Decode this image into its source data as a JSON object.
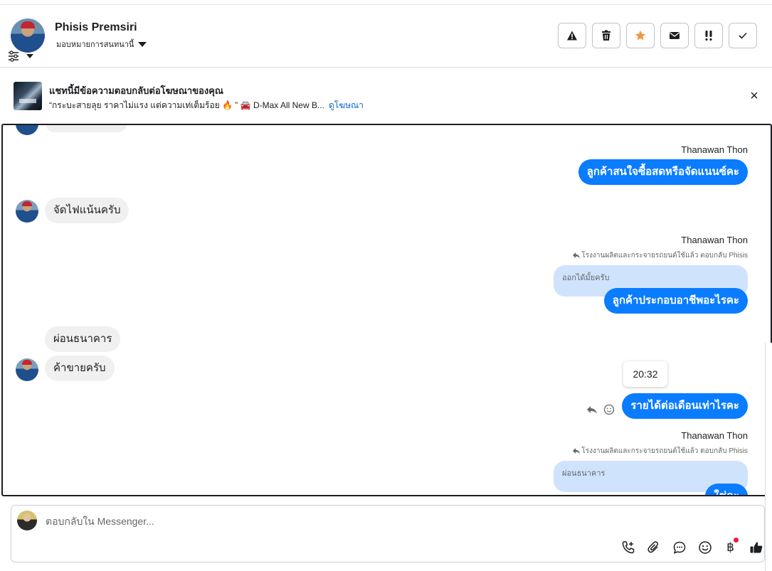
{
  "header": {
    "contact_name": "Phisis Premsiri",
    "assign_label": "มอบหมายการสนทนานี้",
    "actions": [
      {
        "name": "spam-button",
        "icon": "warning-icon"
      },
      {
        "name": "delete-button",
        "icon": "trash-icon"
      },
      {
        "name": "star-button",
        "icon": "star-icon"
      },
      {
        "name": "mark-unread-button",
        "icon": "envelope-icon"
      },
      {
        "name": "follow-up-button",
        "icon": "exclamation-icon"
      },
      {
        "name": "done-button",
        "icon": "check-icon"
      }
    ],
    "star_color": "#f7923b"
  },
  "ad_banner": {
    "title": "แชทนี้มีข้อความตอบกลับต่อโฆษณาของคุณ",
    "subtitle": "“กระบะสายลุย ราคาไม่แรง แต่ความเท่เต็มร้อย 🔥 ” 🚘 D-Max All New B...",
    "link": "ดูโฆษณา"
  },
  "messages": {
    "sender_1": "Thanawan Thon",
    "out_1": "ลูกค้าสนใจซื้อสดหรือจัดแนนซ์คะ",
    "in_1": "จัดไฟแน้นครับ",
    "sender_2": "Thanawan Thon",
    "reply_meta_2": "โรงงานผลิตและกระจายรถยนต์ใช้แล้ว ตอบกลับ Phisis",
    "quote_2": "ออกได้มั้ยครับ",
    "out_2": "ลูกค้าประกอบอาชีพอะไรคะ",
    "in_2": "ผ่อนธนาคาร",
    "in_3": "ค้าขายครับ",
    "timestamp": "20:32",
    "out_3": "รายได้ต่อเดือนเท่าไรคะ",
    "sender_3": "Thanawan Thon",
    "reply_meta_3": "โรงงานผลิตและกระจายรถยนต์ใช้แล้ว ตอบกลับ Phisis",
    "quote_3": "ผ่อนธนาคาร",
    "out_4_partial": "ใช่คะ"
  },
  "composer": {
    "placeholder": "ตอบกลับใน Messenger...",
    "tools": [
      "add-call-icon",
      "attach-icon",
      "saved-reply-icon",
      "emoji-icon",
      "baht-payment-icon",
      "thumbs-up-icon"
    ]
  },
  "colors": {
    "outgoing_bubble": "#0a7cff",
    "incoming_bubble": "#f0f0f0",
    "quote_bubble": "#cfe3fc"
  }
}
